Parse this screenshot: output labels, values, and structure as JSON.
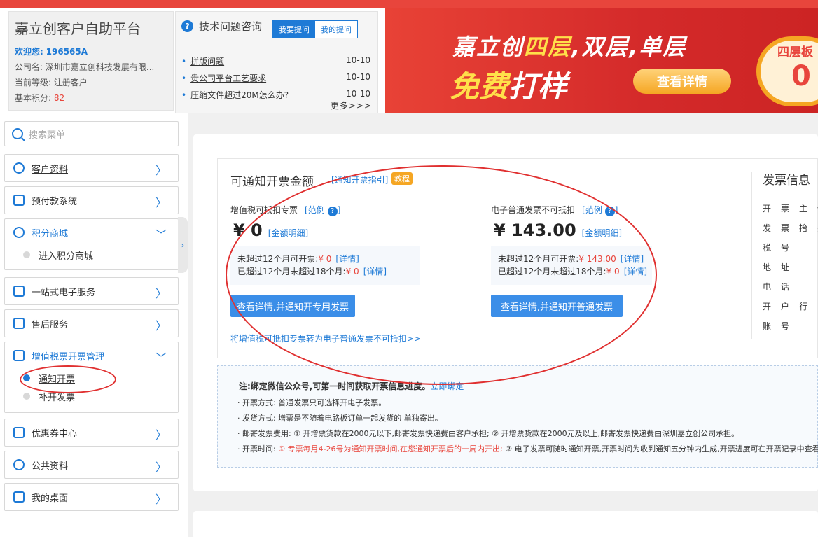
{
  "user": {
    "platform_title": "嘉立创客户自助平台",
    "welcome_label": "欢迎您:",
    "user_id": "196565A",
    "company_label": "公司名:",
    "company_name": "深圳市嘉立创科技发展有限...",
    "level_label": "当前等级:",
    "level_value": "注册客户",
    "points_label": "基本积分:",
    "points_value": "82"
  },
  "tech": {
    "title": "技术问题咨询",
    "tab_ask": "我要提问",
    "tab_mine": "我的提问",
    "questions": [
      {
        "text": "拼版问题",
        "date": "10-10"
      },
      {
        "text": "贵公司平台工艺要求",
        "date": "10-10"
      },
      {
        "text": "压缩文件超过20M怎么办?",
        "date": "10-10"
      }
    ],
    "more": "更多>>>"
  },
  "banner": {
    "line1_a": "嘉立创",
    "line1_hl": "四层",
    "line1_b": ",双层,单层",
    "line2_hl": "免费",
    "line2_b": "打样",
    "button": "查看详情",
    "badge_text": "四层板",
    "badge_value": "0"
  },
  "sidebar": {
    "search_placeholder": "搜索菜单",
    "items": [
      {
        "label": "客户资料",
        "chev": "〉"
      },
      {
        "label": "预付款系统",
        "chev": "〉"
      },
      {
        "label": "积分商城",
        "chev": "﹀",
        "subs": [
          "进入积分商城"
        ]
      },
      {
        "label": "一站式电子服务",
        "chev": "〉"
      },
      {
        "label": "售后服务",
        "chev": "〉"
      },
      {
        "label": "增值税票开票管理",
        "chev": "﹀",
        "subs": [
          "通知开票",
          "补开发票"
        ]
      },
      {
        "label": "优惠券中心",
        "chev": "〉"
      },
      {
        "label": "公共资料",
        "chev": "〉"
      },
      {
        "label": "我的桌面",
        "chev": "〉"
      }
    ],
    "collapse": "›"
  },
  "invoice": {
    "title": "可通知开票金额",
    "guide_link": "[通知开票指引]",
    "tutorial": "教程",
    "vat": {
      "title": "增值税可抵扣专票",
      "example": "[范例",
      "example_close": "]",
      "amount": "¥ 0",
      "detail_link": "[金额明细]",
      "row1_label": "未超过12个月可开票:",
      "row1_value": "¥ 0",
      "row2_label": "已超过12个月未超过18个月:",
      "row2_value": "¥ 0",
      "detail": "[详情]",
      "button": "查看详情,并通知开专用发票"
    },
    "normal": {
      "title": "电子普通发票不可抵扣",
      "example": "[范例",
      "example_close": "]",
      "amount": "¥ 143.00",
      "detail_link": "[金额明细]",
      "row1_label": "未超过12个月可开票:",
      "row1_value": "¥ 143.00",
      "row2_label": "已超过12个月未超过18个月:",
      "row2_value": "¥ 0",
      "detail": "[详情]",
      "button": "查看详情,并通知开普通发票"
    },
    "convert_link": "将增值税可抵扣专票转为电子普通发票不可抵扣>>",
    "info_title": "发票信息",
    "info_fields": [
      "开票主体",
      "发票抬头",
      "税号",
      "地址",
      "电话",
      "开户行",
      "账号"
    ]
  },
  "notes": {
    "head": "注:绑定微信公众号,可第一时间获取开票信息进度。",
    "bind_link": "立即绑定",
    "lines": [
      {
        "label": "· 开票方式:",
        "text": "普通发票只可选择开电子发票。"
      },
      {
        "label": "· 发货方式:",
        "text": "增票是不随着电路板订单一起发货的 单独寄出。"
      },
      {
        "label": "· 邮寄发票费用:",
        "text": "① 开增票货款在2000元以下,邮寄发票快递费由客户承担; ② 开增票货款在2000元及以上,邮寄发票快递费由深圳嘉立创公司承担。"
      }
    ],
    "time_label": "· 开票时间:",
    "time_red": "① 专票每月4-26号为通知开票时间,在您通知开票后的一周内开出;",
    "time_text": "② 电子发票可随时通知开票,开票时间为收到通知五分钟内生成,开票进度可在开票记录中查看"
  }
}
